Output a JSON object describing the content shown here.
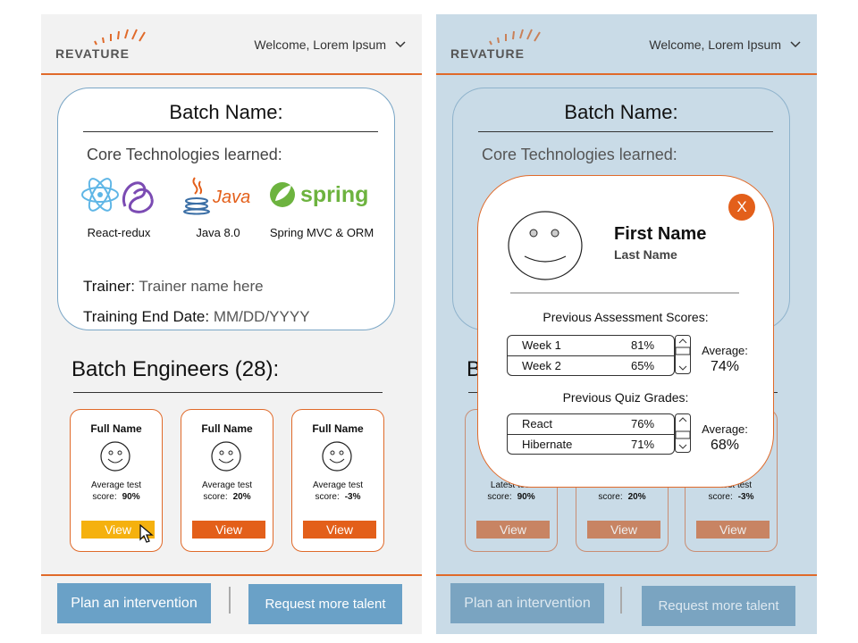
{
  "brand": {
    "logo_text": "REVATURE",
    "accent": "#e06a2a",
    "button_blue": "#6aa1c7"
  },
  "header": {
    "welcome": "Welcome, Lorem Ipsum"
  },
  "batch": {
    "title": "Batch Name:",
    "core_label": "Core Technologies learned:",
    "technologies": [
      {
        "icon": "react-redux-icon",
        "label": "React-redux"
      },
      {
        "icon": "java-icon",
        "label": "Java 8.0",
        "logo_text": "Java"
      },
      {
        "icon": "spring-icon",
        "label": "Spring MVC & ORM",
        "logo_text": "spring"
      }
    ],
    "trainer_key": "Trainer:",
    "trainer_val": "Trainer name here",
    "end_key": "Training End Date:",
    "end_val": "MM/DD/YYYY"
  },
  "engineers": {
    "title": "Batch Engineers (28):",
    "title_short": "B",
    "cards": [
      {
        "name": "Full Name",
        "score_line1": "Average test",
        "score_line1_alt": "Latest test",
        "score_key": "score:",
        "score": "90%",
        "view": "View"
      },
      {
        "name": "Full Name",
        "score_line1": "Average test",
        "score_line1_alt": "Latest test",
        "score_key": "score:",
        "score": "20%",
        "view": "View"
      },
      {
        "name": "Full Name",
        "score_line1": "Average test",
        "score_line1_alt": "Latest test",
        "score_key": "score:",
        "score": "-3%",
        "view": "View"
      }
    ]
  },
  "footer": {
    "intervention": "Plan an intervention",
    "request": "Request more talent"
  },
  "modal": {
    "close": "X",
    "first_name": "First Name",
    "last_name": "Last Name",
    "assessment_title": "Previous Assessment Scores:",
    "assessments": [
      {
        "k": "Week 1",
        "v": "81%"
      },
      {
        "k": "Week 2",
        "v": "65%"
      }
    ],
    "assessment_avg_label": "Average:",
    "assessment_avg": "74%",
    "quiz_title": "Previous Quiz Grades:",
    "quizzes": [
      {
        "k": "React",
        "v": "76%"
      },
      {
        "k": "Hibernate",
        "v": "71%"
      }
    ],
    "quiz_avg_label": "Average:",
    "quiz_avg": "68%"
  }
}
